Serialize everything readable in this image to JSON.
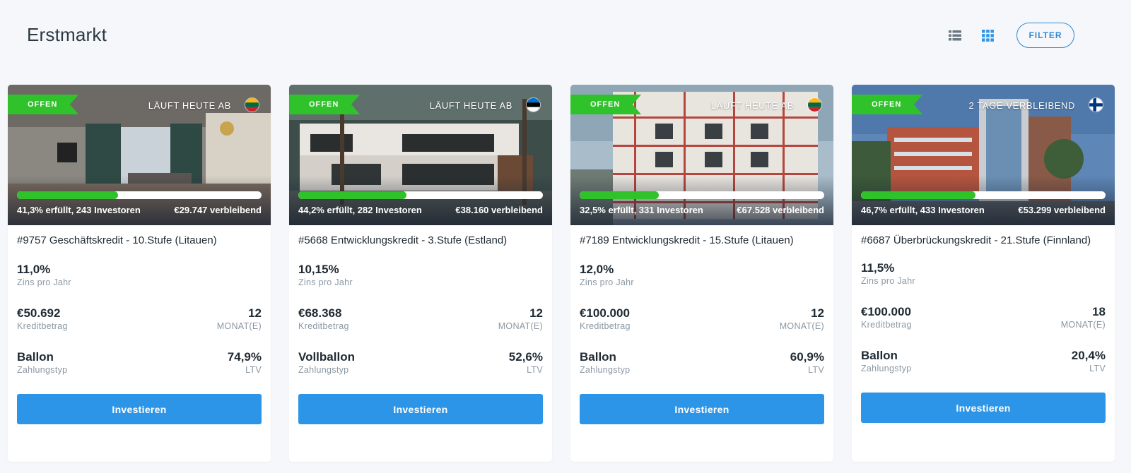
{
  "page": {
    "title": "Erstmarkt"
  },
  "toolbar": {
    "filter_label": "FILTER",
    "list_view_icon": "list-view-icon",
    "grid_view_icon": "grid-view-icon",
    "accent": "#2d8ad6"
  },
  "cards": [
    {
      "status": "OFFEN",
      "time_left": "LÄUFT HEUTE AB",
      "flag": "lithuania",
      "progress": 0.413,
      "funded_text": "41,3% erfüllt, 243 Investoren",
      "remaining_text": "€29.747 verbleibend",
      "title": "#9757 Geschäftskredit - 10.Stufe (Litauen)",
      "rate": "11,0%",
      "rate_label": "Zins pro Jahr",
      "amount": "€50.692",
      "amount_label": "Kreditbetrag",
      "term": "12",
      "term_label": "MONAT(E)",
      "payment_type": "Ballon",
      "payment_type_label": "Zahlungstyp",
      "ltv": "74,9%",
      "ltv_label": "LTV",
      "invest_label": "Investieren"
    },
    {
      "status": "OFFEN",
      "time_left": "LÄUFT HEUTE AB",
      "flag": "estonia",
      "progress": 0.442,
      "funded_text": "44,2% erfüllt, 282 Investoren",
      "remaining_text": "€38.160 verbleibend",
      "title": "#5668 Entwicklungskredit - 3.Stufe (Estland)",
      "rate": "10,15%",
      "rate_label": "Zins pro Jahr",
      "amount": "€68.368",
      "amount_label": "Kreditbetrag",
      "term": "12",
      "term_label": "MONAT(E)",
      "payment_type": "Vollballon",
      "payment_type_label": "Zahlungstyp",
      "ltv": "52,6%",
      "ltv_label": "LTV",
      "invest_label": "Investieren"
    },
    {
      "status": "OFFEN",
      "time_left": "LÄUFT HEUTE AB",
      "flag": "lithuania",
      "progress": 0.325,
      "funded_text": "32,5% erfüllt, 331 Investoren",
      "remaining_text": "€67.528 verbleibend",
      "title": "#7189 Entwicklungskredit - 15.Stufe (Litauen)",
      "rate": "12,0%",
      "rate_label": "Zins pro Jahr",
      "amount": "€100.000",
      "amount_label": "Kreditbetrag",
      "term": "12",
      "term_label": "MONAT(E)",
      "payment_type": "Ballon",
      "payment_type_label": "Zahlungstyp",
      "ltv": "60,9%",
      "ltv_label": "LTV",
      "invest_label": "Investieren"
    },
    {
      "status": "OFFEN",
      "time_left": "2 TAGE VERBLEIBEND",
      "flag": "finland",
      "progress": 0.467,
      "funded_text": "46,7% erfüllt, 433 Investoren",
      "remaining_text": "€53.299 verbleibend",
      "title": "#6687 Überbrückungskredit - 21.Stufe (Finnland)",
      "rate": "11,5%",
      "rate_label": "Zins pro Jahr",
      "amount": "€100.000",
      "amount_label": "Kreditbetrag",
      "term": "18",
      "term_label": "MONAT(E)",
      "payment_type": "Ballon",
      "payment_type_label": "Zahlungstyp",
      "ltv": "20,4%",
      "ltv_label": "LTV",
      "invest_label": "Investieren"
    }
  ]
}
